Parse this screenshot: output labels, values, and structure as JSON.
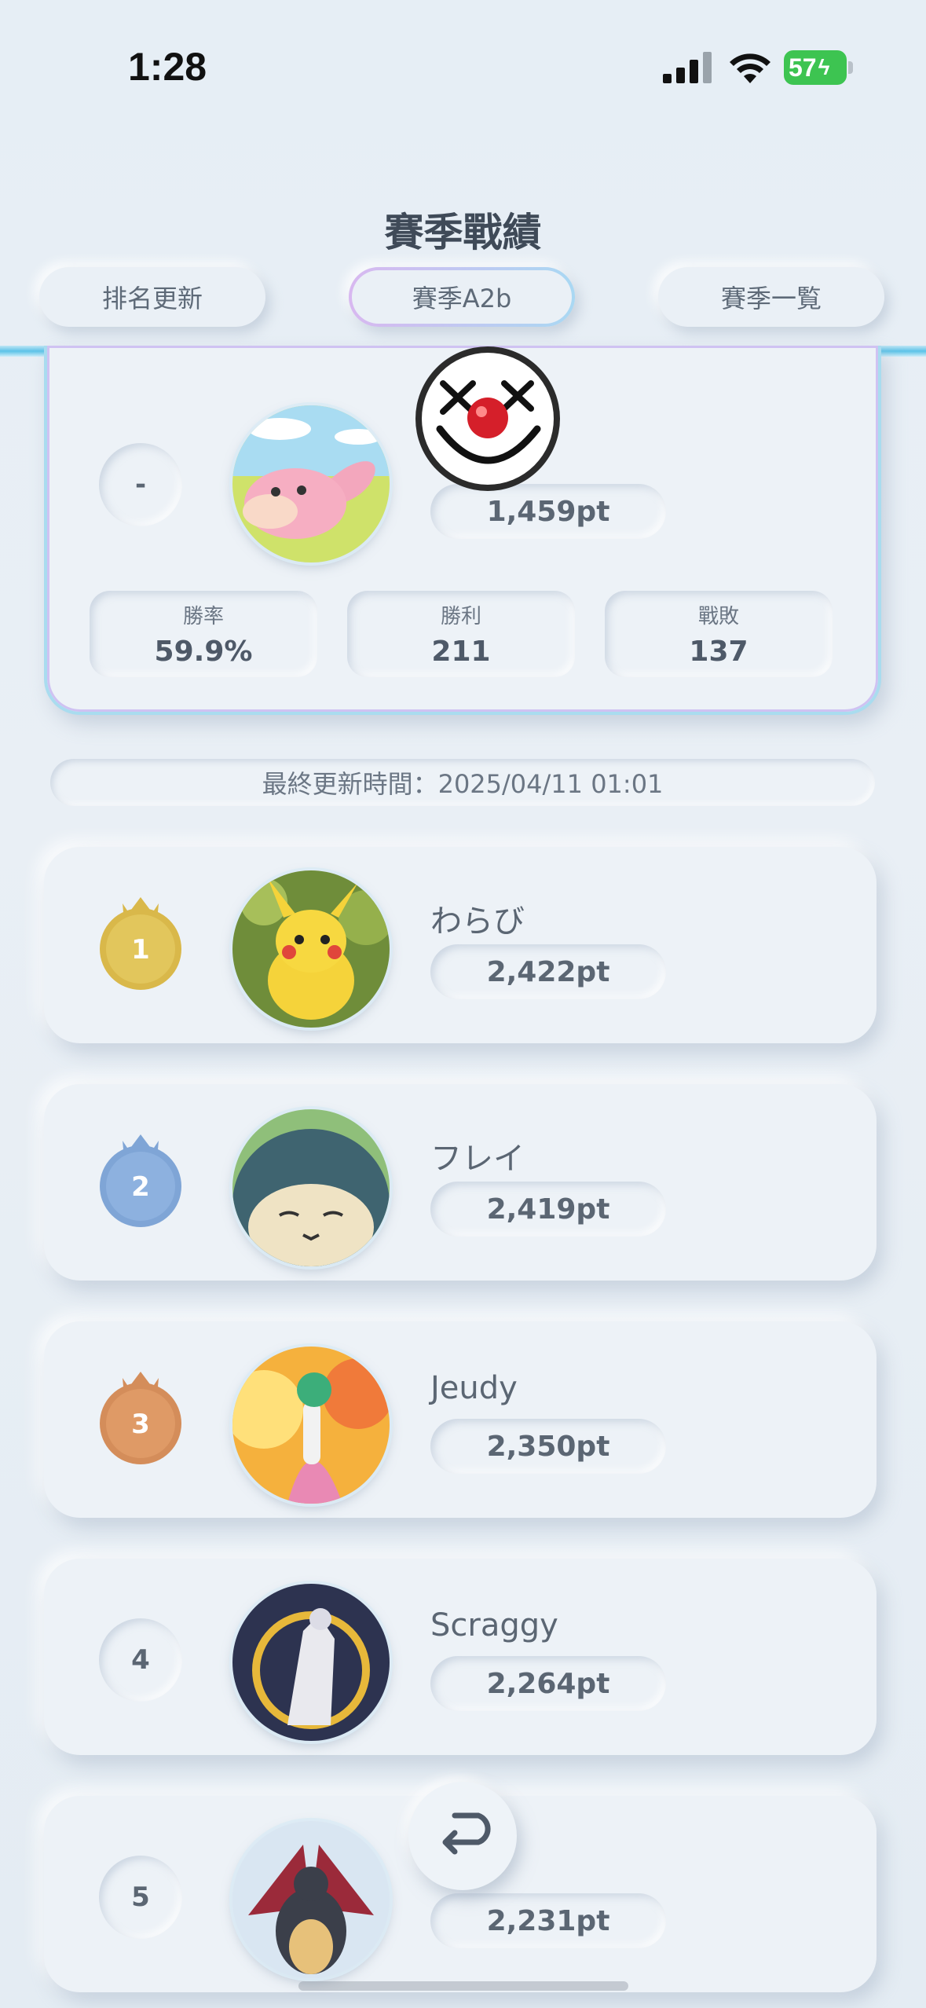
{
  "status_bar": {
    "time": "1:28",
    "battery": "57"
  },
  "page": {
    "title": "賽季戰績"
  },
  "tabs": [
    {
      "label": "排名更新"
    },
    {
      "label": "賽季A2b"
    },
    {
      "label": "賽季一覧"
    }
  ],
  "my_record": {
    "rank": "-",
    "points": "1,459pt",
    "stats": [
      {
        "label": "勝率",
        "value": "59.9%"
      },
      {
        "label": "勝利",
        "value": "211"
      },
      {
        "label": "戰敗",
        "value": "137"
      }
    ]
  },
  "last_updated": "最終更新時間：2025/04/11 01:01",
  "leaderboard": [
    {
      "rank": "1",
      "name": "わらび",
      "points": "2,422pt"
    },
    {
      "rank": "2",
      "name": "フレイ",
      "points": "2,419pt"
    },
    {
      "rank": "3",
      "name": "Jeudy",
      "points": "2,350pt"
    },
    {
      "rank": "4",
      "name": "Scraggy",
      "points": "2,264pt"
    },
    {
      "rank": "5",
      "name": "",
      "points": "2,231pt"
    }
  ],
  "colors": {
    "gold": "#d9b84a",
    "silver": "#7fa5d6",
    "bronze": "#d48d5a",
    "accent": "#5cc3e8"
  }
}
